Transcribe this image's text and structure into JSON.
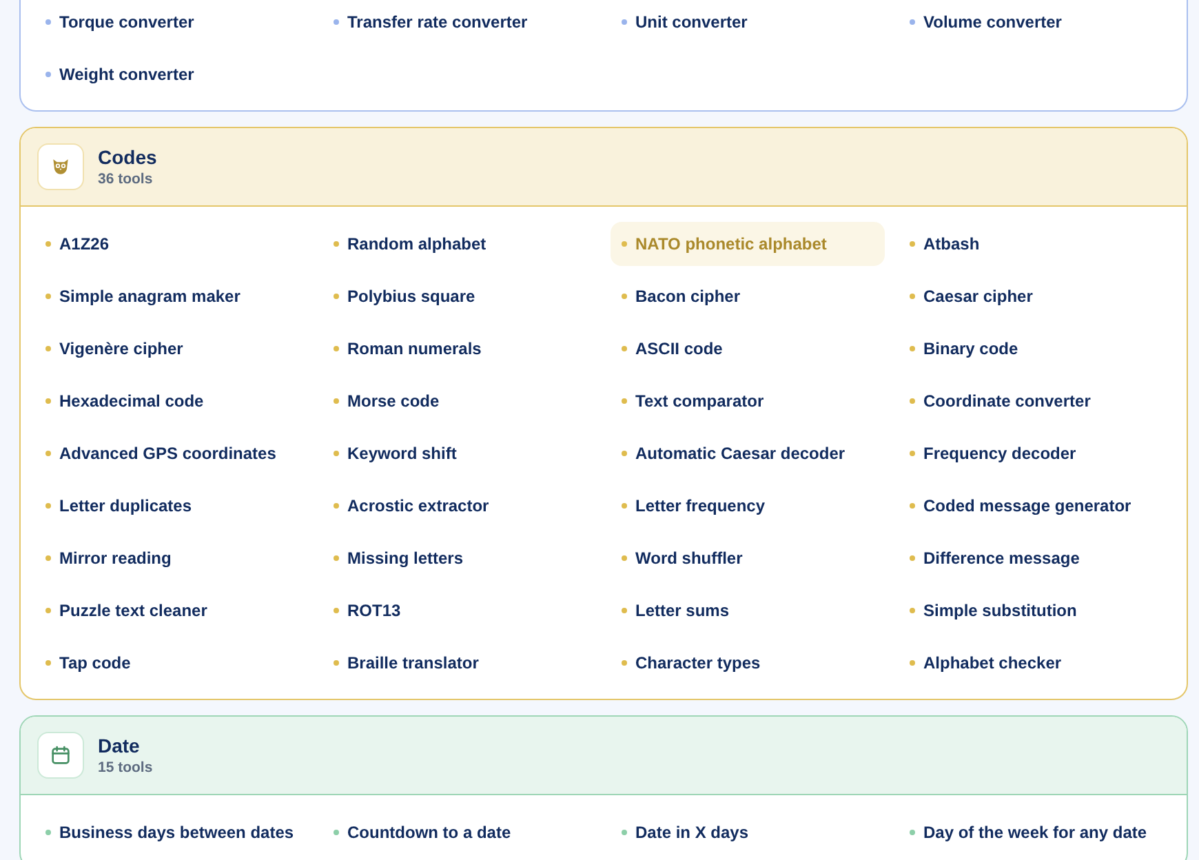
{
  "categories": [
    {
      "color": "#9ab4ec",
      "items": [
        {
          "label": "Torque converter",
          "selected": false
        },
        {
          "label": "Transfer rate converter",
          "selected": false
        },
        {
          "label": "Unit converter",
          "selected": false
        },
        {
          "label": "Volume converter",
          "selected": false
        },
        {
          "label": "Weight converter",
          "selected": false
        }
      ]
    },
    {
      "title": "Codes",
      "count": "36 tools",
      "color": "#dfbc4e",
      "items": [
        {
          "label": "A1Z26",
          "selected": false
        },
        {
          "label": "Random alphabet",
          "selected": false
        },
        {
          "label": "NATO phonetic alphabet",
          "selected": true
        },
        {
          "label": "Atbash",
          "selected": false
        },
        {
          "label": "Simple anagram maker",
          "selected": false
        },
        {
          "label": "Polybius square",
          "selected": false
        },
        {
          "label": "Bacon cipher",
          "selected": false
        },
        {
          "label": "Caesar cipher",
          "selected": false
        },
        {
          "label": "Vigenère cipher",
          "selected": false
        },
        {
          "label": "Roman numerals",
          "selected": false
        },
        {
          "label": "ASCII code",
          "selected": false
        },
        {
          "label": "Binary code",
          "selected": false
        },
        {
          "label": "Hexadecimal code",
          "selected": false
        },
        {
          "label": "Morse code",
          "selected": false
        },
        {
          "label": "Text comparator",
          "selected": false
        },
        {
          "label": "Coordinate converter",
          "selected": false
        },
        {
          "label": "Advanced GPS coordinates",
          "selected": false
        },
        {
          "label": "Keyword shift",
          "selected": false
        },
        {
          "label": "Automatic Caesar decoder",
          "selected": false
        },
        {
          "label": "Frequency decoder",
          "selected": false
        },
        {
          "label": "Letter duplicates",
          "selected": false
        },
        {
          "label": "Acrostic extractor",
          "selected": false
        },
        {
          "label": "Letter frequency",
          "selected": false
        },
        {
          "label": "Coded message generator",
          "selected": false
        },
        {
          "label": "Mirror reading",
          "selected": false
        },
        {
          "label": "Missing letters",
          "selected": false
        },
        {
          "label": "Word shuffler",
          "selected": false
        },
        {
          "label": "Difference message",
          "selected": false
        },
        {
          "label": "Puzzle text cleaner",
          "selected": false
        },
        {
          "label": "ROT13",
          "selected": false
        },
        {
          "label": "Letter sums",
          "selected": false
        },
        {
          "label": "Simple substitution",
          "selected": false
        },
        {
          "label": "Tap code",
          "selected": false
        },
        {
          "label": "Braille translator",
          "selected": false
        },
        {
          "label": "Character types",
          "selected": false
        },
        {
          "label": "Alphabet checker",
          "selected": false
        }
      ]
    },
    {
      "title": "Date",
      "count": "15 tools",
      "color": "#8dcfa9",
      "items": [
        {
          "label": "Business days between dates",
          "selected": false
        },
        {
          "label": "Countdown to a date",
          "selected": false
        },
        {
          "label": "Date in X days",
          "selected": false
        },
        {
          "label": "Day of the week for any date",
          "selected": false
        }
      ]
    }
  ]
}
